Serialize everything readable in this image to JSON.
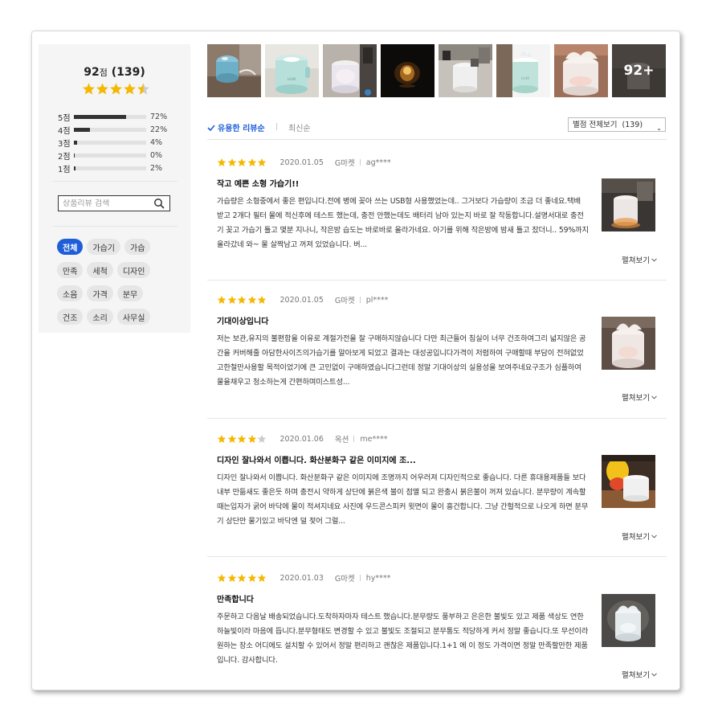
{
  "summary": {
    "score": "92",
    "score_unit": "점",
    "count": "(139)",
    "stars": 4.5,
    "distribution": [
      {
        "label": "5점",
        "percent": 72,
        "pct_text": "72%"
      },
      {
        "label": "4점",
        "percent": 22,
        "pct_text": "22%"
      },
      {
        "label": "3점",
        "percent": 4,
        "pct_text": "4%"
      },
      {
        "label": "2점",
        "percent": 0,
        "pct_text": "0%"
      },
      {
        "label": "1점",
        "percent": 2,
        "pct_text": "2%"
      }
    ]
  },
  "search": {
    "placeholder": "상품리뷰 검색",
    "icon": "search-icon"
  },
  "tags": [
    "전체",
    "가습기",
    "가습",
    "만족",
    "세척",
    "디자인",
    "소음",
    "가격",
    "분무",
    "건조",
    "소리",
    "사무실"
  ],
  "active_tag": "전체",
  "photos": {
    "more_label": "92+"
  },
  "sort": {
    "useful": "유용한 리뷰순",
    "recent": "최신순"
  },
  "filter": {
    "label": "별점 전체보기",
    "count": "(139)"
  },
  "colors": {
    "accent": "#1f5ed8",
    "star": "#f5b800",
    "star_empty": "#cccccc"
  },
  "reviews": [
    {
      "stars": 5,
      "date": "2020.01.05",
      "store": "G마켓",
      "user": "ag****",
      "title": "작고 예쁜 소형 가습기!!",
      "body": "가습량은 소형중에서 좋은 편입니다.전에 병에 꽂아 쓰는 USB형 사용했었는데.. 그거보다 가습량이 조금 더 좋네요.택배 받고 2개다 필터 물에 적신후에 테스트 했는데, 충전 안했는데도 배터리 남아 있는지 바로 잘 작동합니다.설명서대로 충전기 꽂고 가습기 틀고 몇분 지나니, 작은방 습도는 바로바로 올라가네요. 아기를 위해 작은방에 밤새 틀고 잤더니.. 59%까지 올라갔네 와~ 물 살짝남고 꺼져 있었습니다. 버...",
      "more": "펼쳐보기"
    },
    {
      "stars": 5,
      "date": "2020.01.05",
      "store": "G마켓",
      "user": "pl****",
      "title": "기대이상입니다",
      "body": "저는 보관,유지의 불편함을 이유로 계절가전을 잘 구매하지않습니다 다만 최근들어 침실이 너무 건조하여그리 넓지않은 공간을 커버해줄 아담한사이즈의가습기를 알아보게 되었고 결과는 대성공입니다가격이 저렴하여 구매할때 부담이 전혀없었고한철만사용할 목적이었기에 큰 고민없이 구매하였습니다그런데 정말 기대이상의 실용성을 보여주네요구조가 심플하여 물을채우고 청소하는게 간편하며미스트성...",
      "more": "펼쳐보기"
    },
    {
      "stars": 4,
      "date": "2020.01.06",
      "store": "옥션",
      "user": "me****",
      "title": "디자인 잘나와서 이쁩니다. 화산분화구 같은 이미지에 조...",
      "body": "디자인 잘나와서 이쁩니다. 화산분화구 같은 이미지에 조명까지 어우러져 디자인적으로 좋습니다. 다른 휴대용제품들 보다 내부 만듦새도 좋은듯 하며 충전시 약하게 상단에 붉은색 불이 점멸 되고 완충시 붉은불이 꺼져 있습니다. 분무량이 계속할때는입자가 굵어 바닥에 물이 적셔지네요 사진에 우드콘스피커 윗면이 물이 흥건합니다. 그냥 간헐적으로 나오게 하면 분무기 상단만 물기있고 바닥엔 덜 젖어 그럴...",
      "more": "펼쳐보기"
    },
    {
      "stars": 5,
      "date": "2020.01.03",
      "store": "G마켓",
      "user": "hy****",
      "title": "만족합니다",
      "body": "주문하고 다음날 배송되었습니다.도착하자마자 테스트 했습니다.분무량도 풍부하고 은은한 불빛도 있고 제품 색상도 연한 하늘빛이라 마음에 듭니다.분무형태도 변경할 수 있고 불빛도 조절되고 분무통도 적당하게 커서 정말 좋습니다.또 무선이라 원하는 장소 어디에도 설치할 수 있어서 정말 편리하고 괜찮은 제품입니다.1+1 에 이 정도 가격이면 정말 만족할만한 제품입니다. 감사합니다.",
      "more": "펼쳐보기"
    }
  ]
}
